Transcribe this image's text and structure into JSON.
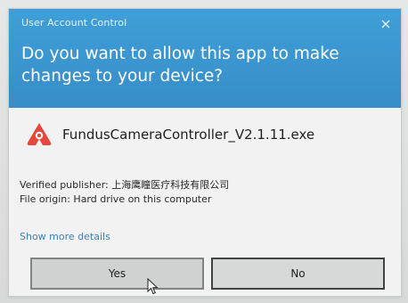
{
  "dialog": {
    "title": "User Account Control",
    "question": "Do you want to allow this app to make changes to your device?",
    "close_icon": "close-icon",
    "app": {
      "name": "FundusCameraController_V2.1.11.exe",
      "icon": "app-logo-icon",
      "icon_color": "#e3483d"
    },
    "publisher": "Verified publisher: 上海鹰瞳医疗科技有限公司",
    "origin": "File origin: Hard drive on this computer",
    "more_details": "Show more details",
    "buttons": {
      "yes": "Yes",
      "no": "No"
    },
    "colors": {
      "header": "#3b95cf",
      "link": "#3a7fbf",
      "body": "#f1f2f1"
    }
  }
}
